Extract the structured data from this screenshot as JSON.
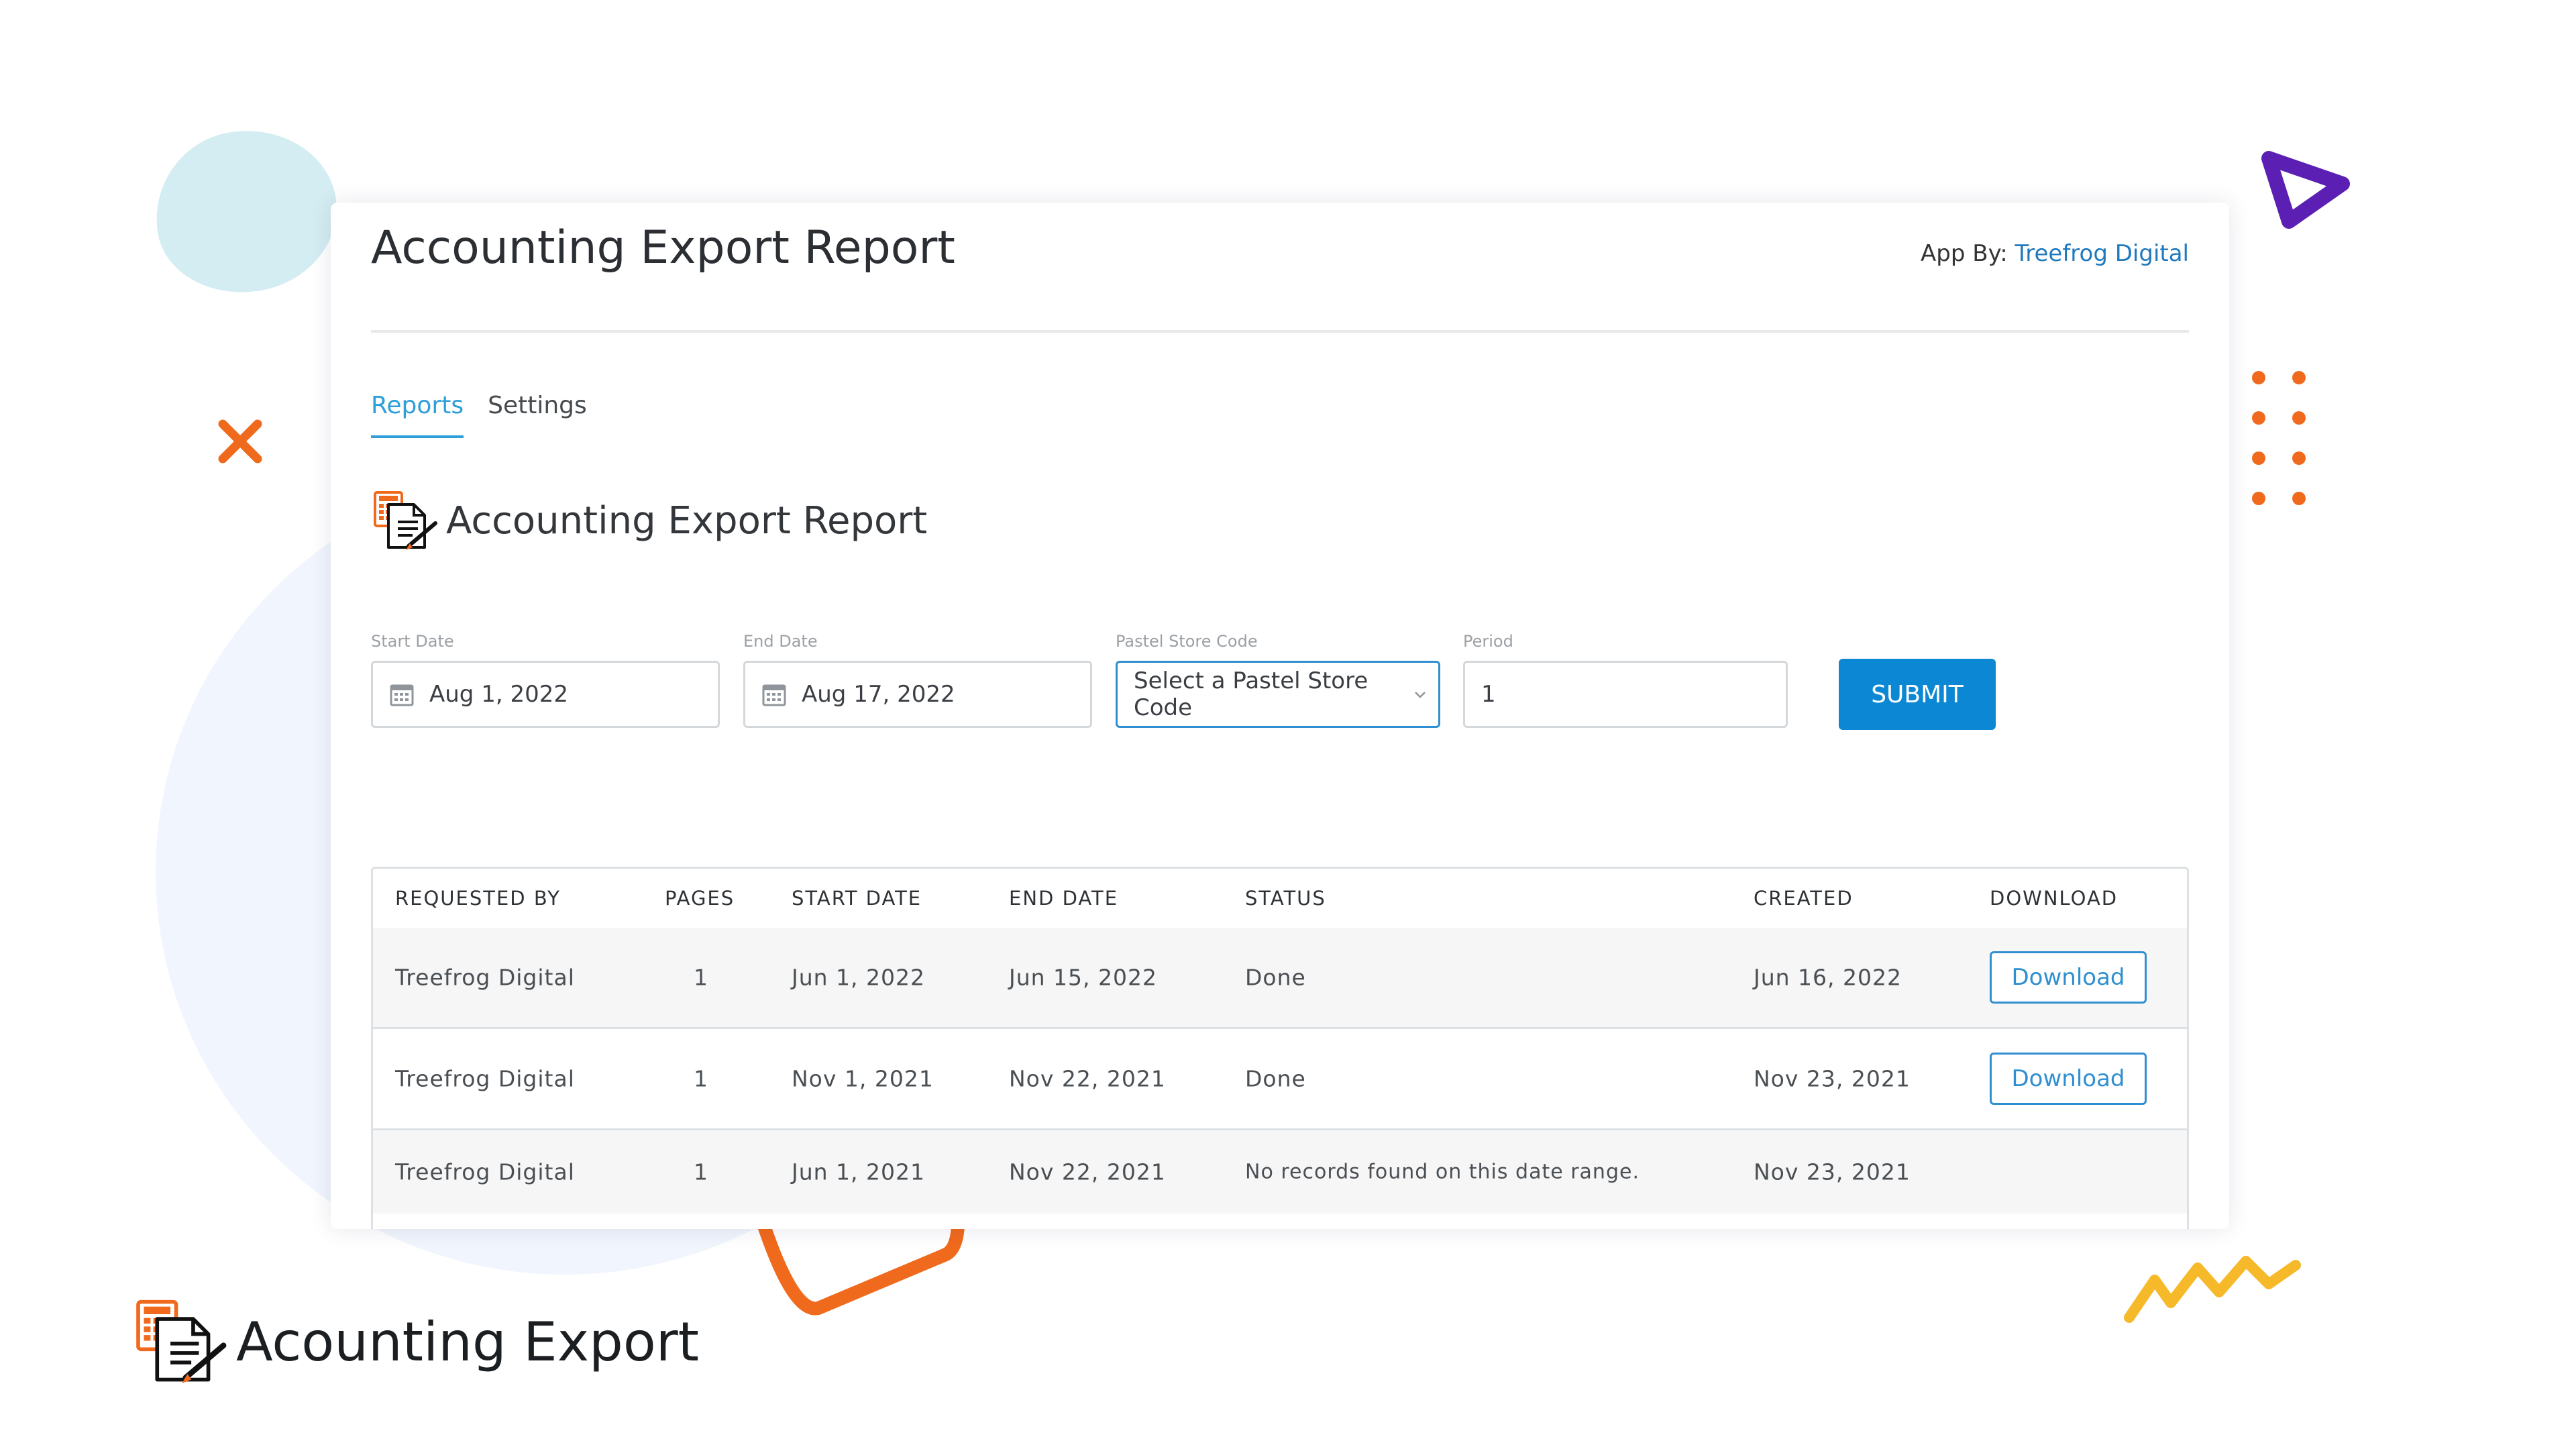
{
  "header": {
    "title": "Accounting Export Report",
    "app_by_label": "App By:",
    "app_by_link": "Treefrog Digital"
  },
  "tabs": [
    {
      "label": "Reports",
      "active": true
    },
    {
      "label": "Settings",
      "active": false
    }
  ],
  "section": {
    "title": "Accounting Export Report",
    "icon": "calculator-document-icon"
  },
  "form": {
    "start_date": {
      "label": "Start Date",
      "value": "Aug 1, 2022"
    },
    "end_date": {
      "label": "End Date",
      "value": "Aug 17, 2022"
    },
    "store_code": {
      "label": "Pastel Store Code",
      "value": "Select a Pastel Store Code"
    },
    "period": {
      "label": "Period",
      "value": "1"
    },
    "submit_label": "SUBMIT"
  },
  "table": {
    "columns": [
      "REQUESTED BY",
      "PAGES",
      "START DATE",
      "END DATE",
      "STATUS",
      "CREATED",
      "DOWNLOAD"
    ],
    "rows": [
      {
        "requested_by": "Treefrog Digital",
        "pages": "1",
        "start": "Jun 1, 2022",
        "end": "Jun 15, 2022",
        "status": "Done",
        "created": "Jun 16, 2022",
        "download": "Download"
      },
      {
        "requested_by": "Treefrog Digital",
        "pages": "1",
        "start": "Nov 1, 2021",
        "end": "Nov 22, 2021",
        "status": "Done",
        "created": "Nov 23, 2021",
        "download": "Download"
      },
      {
        "requested_by": "Treefrog Digital",
        "pages": "1",
        "start": "Jun 1, 2021",
        "end": "Nov 22, 2021",
        "status": "No records found on this date range.",
        "created": "Nov 23, 2021",
        "download": ""
      }
    ]
  },
  "brand": {
    "name": "Acounting Export"
  },
  "colors": {
    "accent": "#2f9fda",
    "button": "#0b87d4",
    "orange": "#f06a1d",
    "purple": "#5b1fb4",
    "yellow": "#f6b92a"
  }
}
